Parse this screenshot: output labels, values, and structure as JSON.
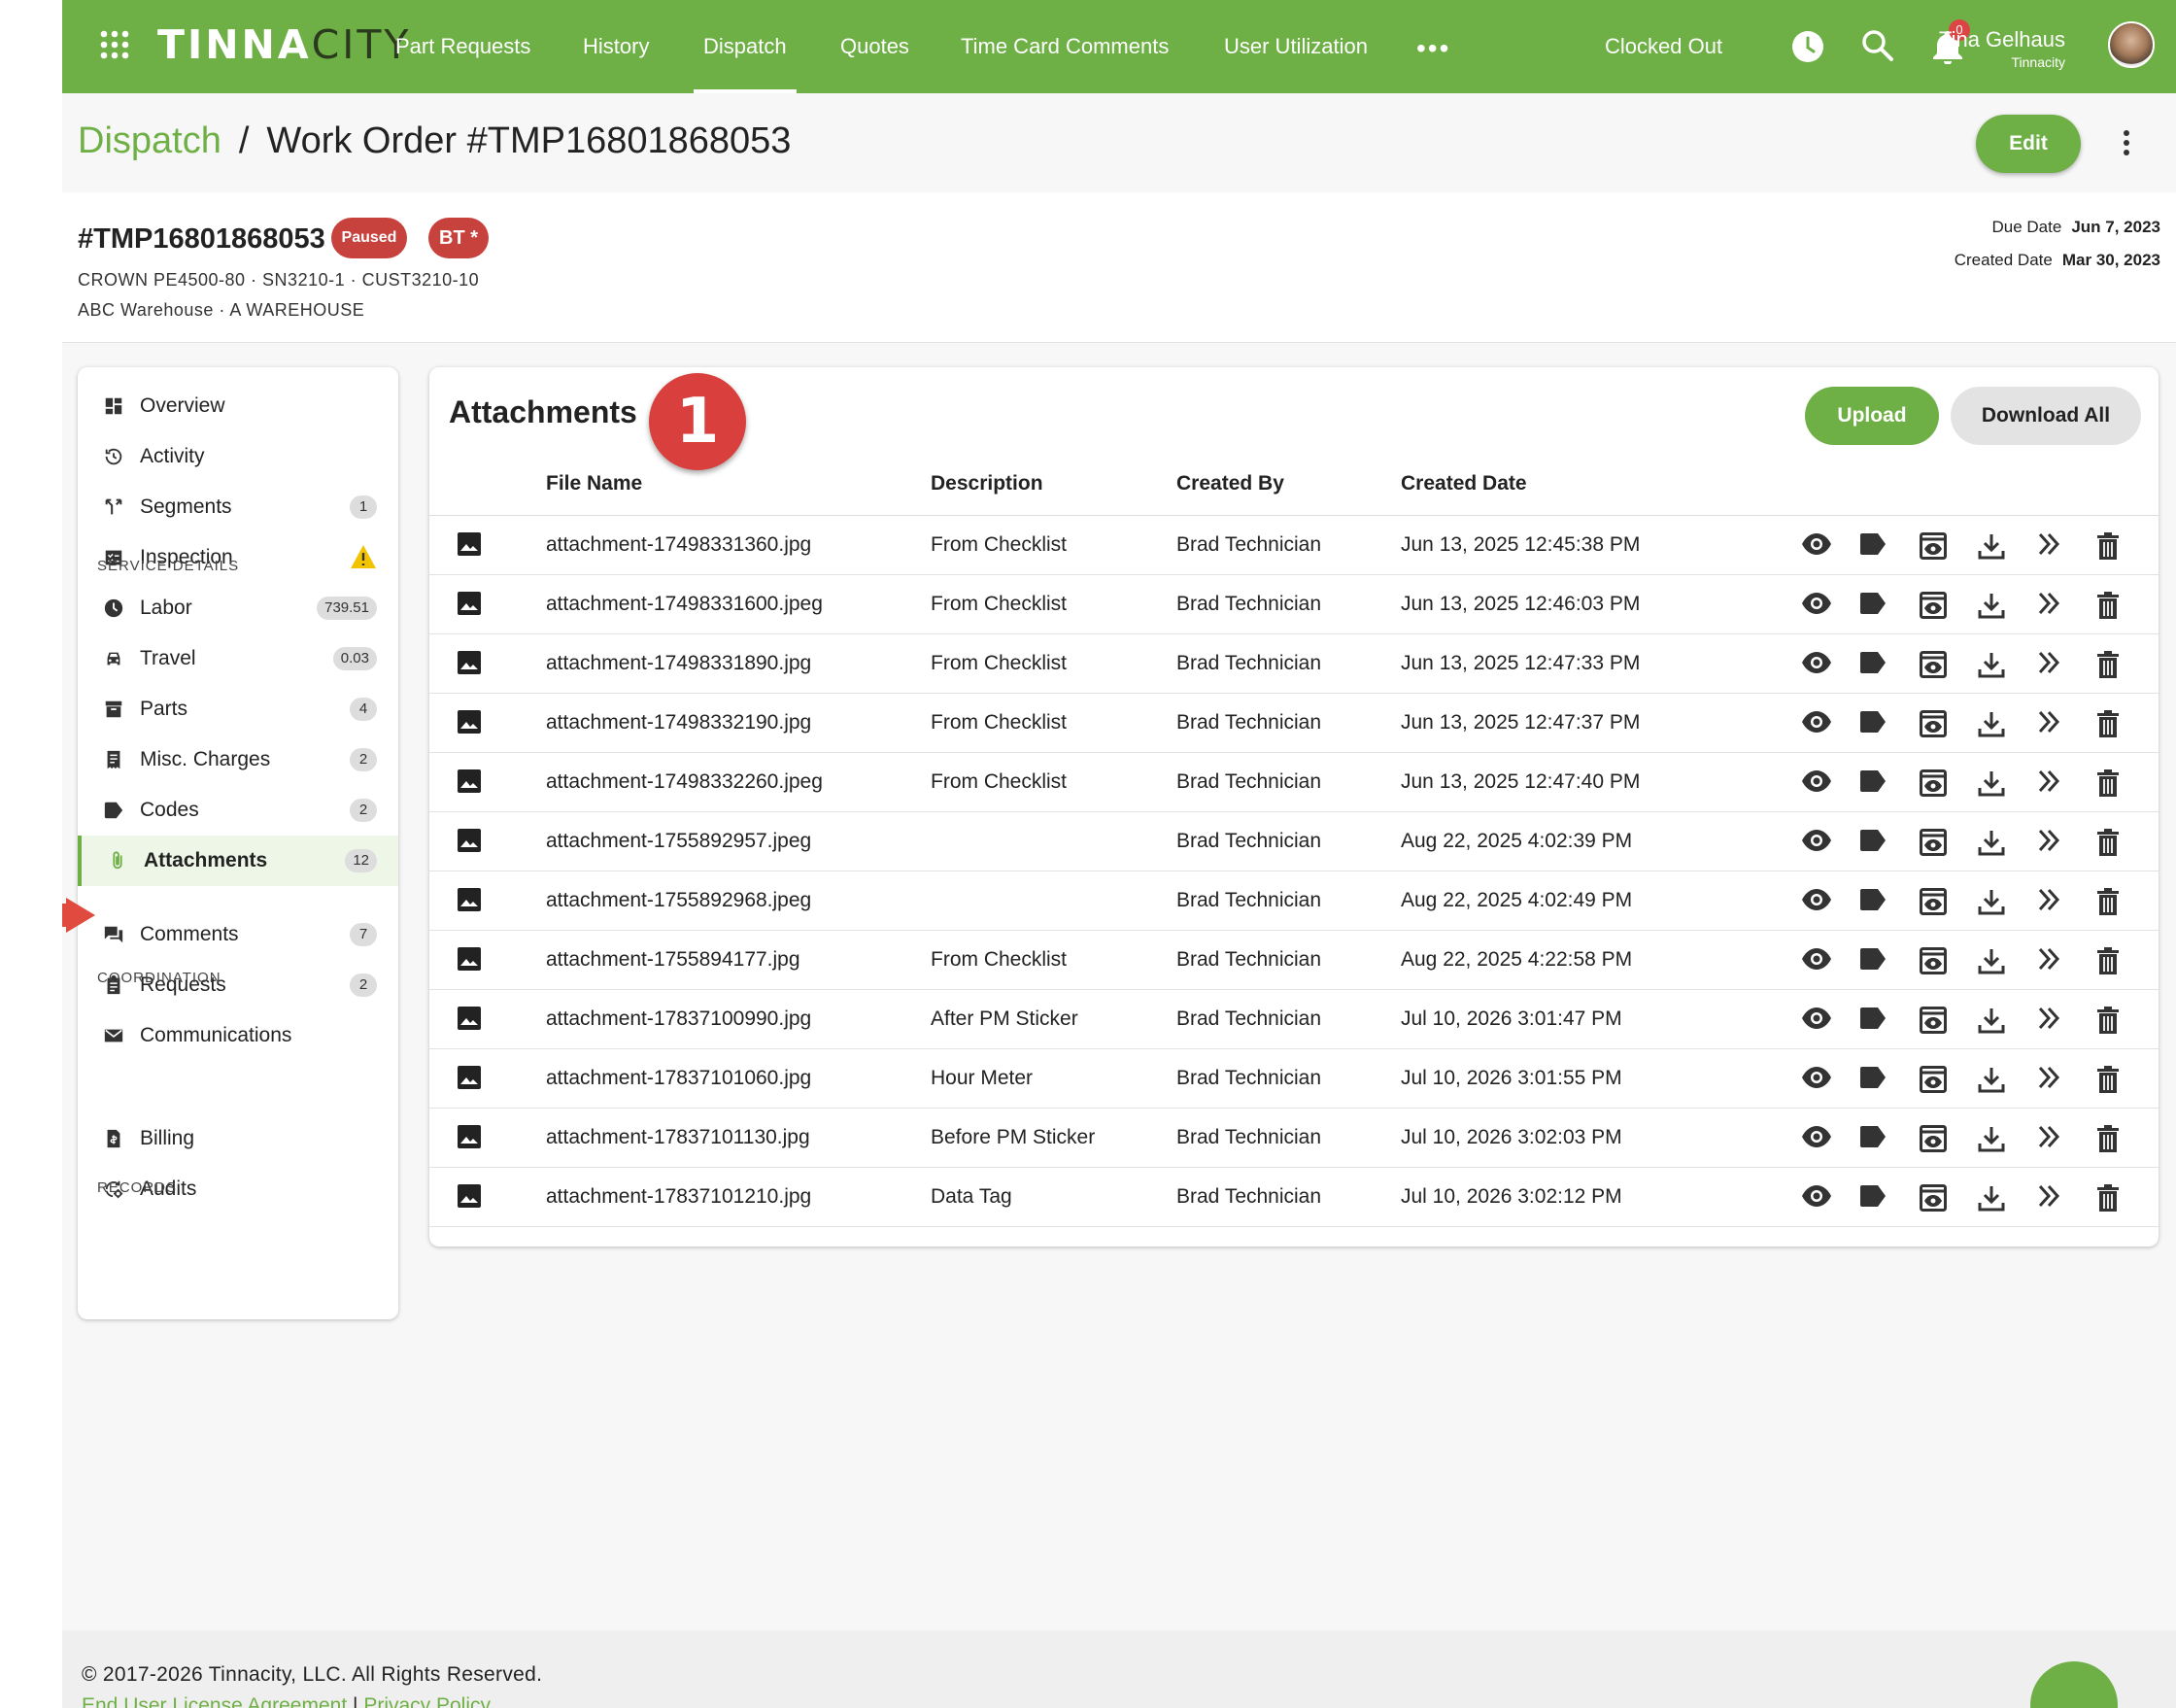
{
  "topbar": {
    "logo_main": "TINNA",
    "logo_tail": "CITY",
    "nav": [
      "Part Requests",
      "History",
      "Dispatch",
      "Quotes",
      "Time Card Comments",
      "User Utilization"
    ],
    "more": "•••",
    "clock_status": "Clocked Out",
    "notification_count": "0",
    "user_name": "Tina Gelhaus",
    "user_org": "Tinnacity"
  },
  "breadcrumb": {
    "parent": "Dispatch",
    "separator": "/",
    "current": "Work Order #TMP16801868053"
  },
  "edit_label": "Edit",
  "work_order": {
    "id": "#TMP16801868053",
    "status": "Paused",
    "badge": "BT *",
    "line1": "CROWN PE4500-80 · SN3210-1 · CUST3210-10",
    "line2": "ABC Warehouse · A WAREHOUSE",
    "due_label": "Due Date",
    "due_value": "Jun 7, 2023",
    "created_label": "Created Date",
    "created_value": "Mar 30, 2023"
  },
  "sidebar": {
    "items": [
      {
        "label": "Overview",
        "icon": "dashboard-icon"
      },
      {
        "label": "Activity",
        "icon": "history-icon"
      },
      {
        "label": "Segments",
        "icon": "merge-icon",
        "count": "1"
      },
      {
        "label": "Inspection",
        "icon": "checklist-icon",
        "warning": true
      },
      {
        "label": "Labor",
        "icon": "clock-icon",
        "count": "739.51"
      },
      {
        "label": "Travel",
        "icon": "car-icon",
        "count": "0.03"
      },
      {
        "label": "Parts",
        "icon": "archive-icon",
        "count": "4"
      },
      {
        "label": "Misc. Charges",
        "icon": "receipt-icon",
        "count": "2"
      },
      {
        "label": "Codes",
        "icon": "tag-icon",
        "count": "2"
      },
      {
        "label": "Attachments",
        "icon": "paperclip-icon",
        "count": "12",
        "active": true
      },
      {
        "label": "Comments",
        "icon": "forum-icon",
        "count": "7"
      },
      {
        "label": "Requests",
        "icon": "clipboard-icon",
        "count": "2"
      },
      {
        "label": "Communications",
        "icon": "mail-icon"
      },
      {
        "label": "Billing",
        "icon": "invoice-icon"
      },
      {
        "label": "Audits",
        "icon": "audit-icon"
      }
    ],
    "sections": [
      "SERVICE DETAILS",
      "COORDINATION",
      "RECORDS"
    ]
  },
  "attachments": {
    "title": "Attachments",
    "step_number": "1",
    "upload_label": "Upload",
    "download_all_label": "Download All",
    "columns": [
      "File Name",
      "Description",
      "Created By",
      "Created Date"
    ],
    "row_actions": [
      "eye-icon",
      "tag-icon",
      "preview-icon",
      "download-icon",
      "double-chevron-icon",
      "trash-icon"
    ],
    "rows": [
      {
        "file": "attachment-17498331360.jpg",
        "desc": "From Checklist",
        "by": "Brad Technician",
        "date": "Jun 13, 2025 12:45:38 PM"
      },
      {
        "file": "attachment-17498331600.jpeg",
        "desc": "From Checklist",
        "by": "Brad Technician",
        "date": "Jun 13, 2025 12:46:03 PM"
      },
      {
        "file": "attachment-17498331890.jpg",
        "desc": "From Checklist",
        "by": "Brad Technician",
        "date": "Jun 13, 2025 12:47:33 PM"
      },
      {
        "file": "attachment-17498332190.jpg",
        "desc": "From Checklist",
        "by": "Brad Technician",
        "date": "Jun 13, 2025 12:47:37 PM"
      },
      {
        "file": "attachment-17498332260.jpeg",
        "desc": "From Checklist",
        "by": "Brad Technician",
        "date": "Jun 13, 2025 12:47:40 PM"
      },
      {
        "file": "attachment-1755892957.jpeg",
        "desc": "",
        "by": "Brad Technician",
        "date": "Aug 22, 2025 4:02:39 PM"
      },
      {
        "file": "attachment-1755892968.jpeg",
        "desc": "",
        "by": "Brad Technician",
        "date": "Aug 22, 2025 4:02:49 PM"
      },
      {
        "file": "attachment-1755894177.jpg",
        "desc": "From Checklist",
        "by": "Brad Technician",
        "date": "Aug 22, 2025 4:22:58 PM"
      },
      {
        "file": "attachment-17837100990.jpg",
        "desc": "After PM Sticker",
        "by": "Brad Technician",
        "date": "Jul 10, 2026 3:01:47 PM"
      },
      {
        "file": "attachment-17837101060.jpg",
        "desc": "Hour Meter",
        "by": "Brad Technician",
        "date": "Jul 10, 2026 3:01:55 PM"
      },
      {
        "file": "attachment-17837101130.jpg",
        "desc": "Before PM Sticker",
        "by": "Brad Technician",
        "date": "Jul 10, 2026 3:02:03 PM"
      },
      {
        "file": "attachment-17837101210.jpg",
        "desc": "Data Tag",
        "by": "Brad Technician",
        "date": "Jul 10, 2026 3:02:12 PM"
      }
    ]
  },
  "footer": {
    "copyright": "© 2017-2026 Tinnacity, LLC. All Rights Reserved.",
    "eula": "End User License Agreement",
    "separator": "|",
    "privacy": "Privacy Policy"
  },
  "colors": {
    "brand_green": "#6fb046",
    "status_red": "#c7423d",
    "warning_yellow": "#f2c400"
  }
}
